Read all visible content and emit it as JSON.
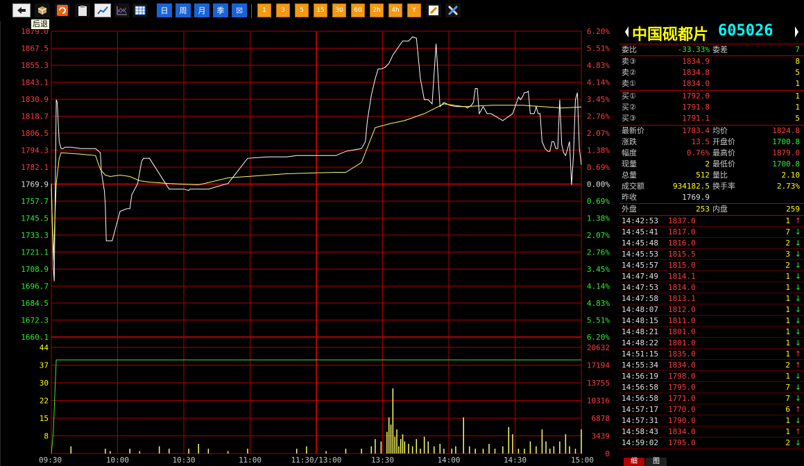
{
  "toolbar": {
    "back_tooltip": "后退",
    "period_buttons": [
      "日",
      "周",
      "月",
      "季",
      "☒"
    ],
    "minute_buttons": [
      "1",
      "3",
      "5",
      "15",
      "30",
      "60",
      "2h",
      "4h",
      "Y"
    ]
  },
  "chart_data": {
    "type": "line",
    "price_axis_left": [
      "1879.0",
      "1867.5",
      "1855.3",
      "1843.1",
      "1830.9",
      "1818.7",
      "1806.5",
      "1794.3",
      "1782.1",
      "1769.9",
      "1757.7",
      "1745.5",
      "1733.3",
      "1721.1",
      "1708.9",
      "1696.7",
      "1684.5",
      "1672.3",
      "1660.1"
    ],
    "pct_axis_right": [
      "6.20%",
      "5.51%",
      "4.83%",
      "4.14%",
      "3.45%",
      "2.76%",
      "2.07%",
      "1.38%",
      "0.69%",
      "0.00%",
      "0.69%",
      "1.38%",
      "2.07%",
      "2.76%",
      "3.45%",
      "4.14%",
      "4.83%",
      "5.51%",
      "6.20%"
    ],
    "vol_axis_left": [
      "44",
      "37",
      "30",
      "22",
      "15",
      "8"
    ],
    "vol_axis_right": [
      "20632",
      "17194",
      "13755",
      "10316",
      "6878",
      "3439",
      "0"
    ],
    "time_labels": [
      "09:30",
      "10:00",
      "10:30",
      "11:00",
      "11:30/13:00",
      "13:30",
      "14:00",
      "14:30",
      "15:00"
    ],
    "ylim": [
      1660.1,
      1879.0
    ],
    "prev_close": 1769.9,
    "series": [
      {
        "color": "#ffffff",
        "x": [
          0,
          2,
          3,
          5,
          6,
          8,
          10,
          12,
          14,
          20,
          30,
          45,
          50,
          51,
          54,
          55,
          56,
          62,
          70,
          77,
          80,
          82,
          85,
          88,
          92,
          94,
          95,
          100,
          120,
          135,
          140,
          141,
          142,
          160,
          170,
          180,
          200,
          220,
          240,
          250,
          290,
          300,
          316,
          320,
          322,
          326,
          330,
          333,
          336,
          340,
          344,
          348,
          352,
          358,
          364,
          368,
          372,
          376,
          380,
          384,
          388,
          392,
          396,
          400,
          406,
          412,
          418,
          420,
          422,
          424,
          426,
          428,
          430,
          432,
          434,
          436,
          440,
          444,
          448,
          460,
          470,
          476,
          478,
          480,
          482,
          484,
          486,
          488,
          492,
          494,
          496,
          498,
          500,
          503,
          506,
          508,
          510,
          512,
          514,
          516,
          518,
          520,
          522,
          524,
          526,
          528,
          530,
          532,
          534,
          536,
          538,
          540
        ],
        "values": [
          1769.9,
          1710.0,
          1700.0,
          1830.0,
          1828.0,
          1800.0,
          1795.0,
          1795.0,
          1796.0,
          1796.0,
          1795.0,
          1795.0,
          1792.0,
          1778.0,
          1765.0,
          1755.0,
          1729.0,
          1729.0,
          1750.0,
          1752.0,
          1752.0,
          1762.0,
          1766.0,
          1770.0,
          1786.0,
          1788.0,
          1788.0,
          1788.0,
          1766.0,
          1766.0,
          1765.0,
          1766.0,
          1766.0,
          1766.0,
          1768.0,
          1770.0,
          1788.0,
          1789.0,
          1789.0,
          1790.0,
          1790.0,
          1793.0,
          1795.0,
          1800.0,
          1815.0,
          1833.0,
          1845.0,
          1852.0,
          1852.0,
          1853.0,
          1856.0,
          1862.0,
          1866.0,
          1872.0,
          1872.0,
          1875.0,
          1874.0,
          1845.0,
          1830.0,
          1830.0,
          1827.0,
          1870.0,
          1825.0,
          1828.0,
          1826.0,
          1825.0,
          1825.0,
          1825.0,
          1825.0,
          1824.0,
          1825.0,
          1826.0,
          1828.0,
          1838.0,
          1838.0,
          1820.0,
          1825.0,
          1820.0,
          1820.0,
          1815.0,
          1820.0,
          1832.0,
          1830.0,
          1832.0,
          1835.0,
          1835.0,
          1836.0,
          1820.0,
          1820.0,
          1825.0,
          1820.0,
          1820.0,
          1800.0,
          1795.0,
          1793.0,
          1793.0,
          1800.0,
          1800.0,
          1795.0,
          1795.0,
          1830.0,
          1798.0,
          1792.0,
          1790.0,
          1795.0,
          1800.0,
          1769.0,
          1790.0,
          1830.0,
          1835.0,
          1795.0,
          1783.4
        ]
      },
      {
        "color": "#ffff66",
        "x": [
          0,
          2,
          5,
          8,
          10,
          30,
          45,
          50,
          55,
          60,
          70,
          80,
          90,
          100,
          120,
          150,
          180,
          200,
          240,
          290,
          300,
          316,
          330,
          346,
          360,
          380,
          400,
          420,
          450,
          480,
          520,
          540
        ],
        "values": [
          1769.9,
          1715.0,
          1770.0,
          1788.0,
          1792.0,
          1791.0,
          1790.0,
          1780.0,
          1776.0,
          1775.0,
          1776.0,
          1775.0,
          1772.0,
          1771.0,
          1770.0,
          1769.0,
          1774.0,
          1775.0,
          1777.0,
          1778.0,
          1778.0,
          1785.0,
          1810.0,
          1813.0,
          1815.0,
          1820.0,
          1827.0,
          1825.0,
          1826.0,
          1826.0,
          1824.0,
          1824.8
        ]
      }
    ],
    "volume_total": [
      39,
      39,
      39,
      39
    ],
    "volume_bars": [
      {
        "x": 20,
        "v": 3
      },
      {
        "x": 55,
        "v": 2
      },
      {
        "x": 60,
        "v": 1
      },
      {
        "x": 80,
        "v": 2
      },
      {
        "x": 90,
        "v": 1
      },
      {
        "x": 110,
        "v": 3
      },
      {
        "x": 120,
        "v": 2
      },
      {
        "x": 140,
        "v": 2
      },
      {
        "x": 150,
        "v": 4
      },
      {
        "x": 160,
        "v": 2
      },
      {
        "x": 180,
        "v": 1
      },
      {
        "x": 200,
        "v": 2
      },
      {
        "x": 250,
        "v": 2
      },
      {
        "x": 260,
        "v": 3
      },
      {
        "x": 280,
        "v": 1
      },
      {
        "x": 300,
        "v": 2
      },
      {
        "x": 316,
        "v": 2
      },
      {
        "x": 326,
        "v": 3
      },
      {
        "x": 330,
        "v": 6
      },
      {
        "x": 336,
        "v": 5
      },
      {
        "x": 342,
        "v": 9
      },
      {
        "x": 344,
        "v": 15
      },
      {
        "x": 346,
        "v": 12
      },
      {
        "x": 348,
        "v": 27
      },
      {
        "x": 350,
        "v": 7
      },
      {
        "x": 352,
        "v": 10
      },
      {
        "x": 354,
        "v": 3
      },
      {
        "x": 356,
        "v": 6
      },
      {
        "x": 358,
        "v": 8
      },
      {
        "x": 360,
        "v": 5
      },
      {
        "x": 364,
        "v": 4
      },
      {
        "x": 368,
        "v": 3
      },
      {
        "x": 372,
        "v": 6
      },
      {
        "x": 376,
        "v": 2
      },
      {
        "x": 380,
        "v": 7
      },
      {
        "x": 384,
        "v": 5
      },
      {
        "x": 390,
        "v": 3
      },
      {
        "x": 396,
        "v": 4
      },
      {
        "x": 400,
        "v": 2
      },
      {
        "x": 408,
        "v": 2
      },
      {
        "x": 412,
        "v": 3
      },
      {
        "x": 420,
        "v": 15
      },
      {
        "x": 426,
        "v": 3
      },
      {
        "x": 432,
        "v": 2
      },
      {
        "x": 440,
        "v": 2
      },
      {
        "x": 446,
        "v": 4
      },
      {
        "x": 452,
        "v": 2
      },
      {
        "x": 460,
        "v": 3
      },
      {
        "x": 466,
        "v": 11
      },
      {
        "x": 470,
        "v": 8
      },
      {
        "x": 476,
        "v": 2
      },
      {
        "x": 482,
        "v": 2
      },
      {
        "x": 488,
        "v": 5
      },
      {
        "x": 494,
        "v": 3
      },
      {
        "x": 500,
        "v": 10
      },
      {
        "x": 504,
        "v": 5
      },
      {
        "x": 508,
        "v": 2
      },
      {
        "x": 512,
        "v": 3
      },
      {
        "x": 518,
        "v": 5
      },
      {
        "x": 524,
        "v": 8
      },
      {
        "x": 528,
        "v": 3
      },
      {
        "x": 534,
        "v": 2
      },
      {
        "x": 540,
        "v": 10
      }
    ]
  },
  "quote": {
    "name": "中国砚都片",
    "code": "605026",
    "weibi_label": "委比",
    "weibi": "-33.33%",
    "weicha_label": "委差",
    "weicha": "7",
    "sells": [
      {
        "label": "卖③",
        "price": "1834.9",
        "vol": "8"
      },
      {
        "label": "卖②",
        "price": "1834.8",
        "vol": "5"
      },
      {
        "label": "卖①",
        "price": "1834.0",
        "vol": "1"
      }
    ],
    "buys": [
      {
        "label": "买①",
        "price": "1792.0",
        "vol": "1"
      },
      {
        "label": "买②",
        "price": "1791.8",
        "vol": "1"
      },
      {
        "label": "买③",
        "price": "1791.1",
        "vol": "5"
      }
    ],
    "stats": [
      {
        "l1": "最新价",
        "v1": "1783.4",
        "c1": "red",
        "l2": "均价",
        "v2": "1824.8",
        "c2": "red"
      },
      {
        "l1": "涨跌",
        "v1": "13.5",
        "c1": "red",
        "l2": "开盘价",
        "v2": "1700.8",
        "c2": "green"
      },
      {
        "l1": "幅度",
        "v1": "0.76%",
        "c1": "red",
        "l2": "最高价",
        "v2": "1879.0",
        "c2": "red"
      },
      {
        "l1": "现量",
        "v1": "2",
        "c1": "yellow",
        "l2": "最低价",
        "v2": "1700.8",
        "c2": "green"
      },
      {
        "l1": "总量",
        "v1": "512",
        "c1": "yellow",
        "l2": "量比",
        "v2": "2.10",
        "c2": "yellow"
      },
      {
        "l1": "成交额",
        "v1": "934182.5",
        "c1": "yellow",
        "l2": "换手率",
        "v2": "2.73%",
        "c2": "yellow"
      },
      {
        "l1": "昨收",
        "v1": "1769.9",
        "c1": "white",
        "l2": "",
        "v2": "",
        "c2": "white"
      }
    ],
    "waipan_label": "外盘",
    "waipan": "253",
    "neipan_label": "内盘",
    "neipan": "259",
    "ticks": [
      {
        "t": "14:42:53",
        "p": "1837.0",
        "v": "1",
        "d": "up"
      },
      {
        "t": "14:45:41",
        "p": "1817.0",
        "v": "7",
        "d": "down"
      },
      {
        "t": "14:45:48",
        "p": "1816.0",
        "v": "2",
        "d": "down"
      },
      {
        "t": "14:45:53",
        "p": "1815.5",
        "v": "3",
        "d": "down"
      },
      {
        "t": "14:45:57",
        "p": "1815.0",
        "v": "2",
        "d": "down"
      },
      {
        "t": "14:47:49",
        "p": "1814.1",
        "v": "1",
        "d": "down"
      },
      {
        "t": "14:47:53",
        "p": "1814.0",
        "v": "1",
        "d": "down"
      },
      {
        "t": "14:47:58",
        "p": "1813.1",
        "v": "1",
        "d": "down"
      },
      {
        "t": "14:48:07",
        "p": "1812.0",
        "v": "1",
        "d": "down"
      },
      {
        "t": "14:48:15",
        "p": "1811.0",
        "v": "1",
        "d": "down"
      },
      {
        "t": "14:48:21",
        "p": "1801.0",
        "v": "1",
        "d": "down"
      },
      {
        "t": "14:48:22",
        "p": "1801.0",
        "v": "1",
        "d": "down"
      },
      {
        "t": "14:51:15",
        "p": "1835.0",
        "v": "1",
        "d": "up"
      },
      {
        "t": "14:55:34",
        "p": "1834.0",
        "v": "2",
        "d": "up"
      },
      {
        "t": "14:56:19",
        "p": "1798.0",
        "v": "1",
        "d": "down"
      },
      {
        "t": "14:56:58",
        "p": "1795.0",
        "v": "7",
        "d": "down"
      },
      {
        "t": "14:56:58",
        "p": "1771.0",
        "v": "7",
        "d": "down"
      },
      {
        "t": "14:57:17",
        "p": "1770.0",
        "v": "6",
        "d": "up"
      },
      {
        "t": "14:57:31",
        "p": "1790.0",
        "v": "1",
        "d": "down"
      },
      {
        "t": "14:58:43",
        "p": "1834.0",
        "v": "1",
        "d": "up"
      },
      {
        "t": "14:59:02",
        "p": "1795.0",
        "v": "2",
        "d": "down"
      }
    ],
    "bottom_tabs": [
      "细",
      "图"
    ]
  }
}
